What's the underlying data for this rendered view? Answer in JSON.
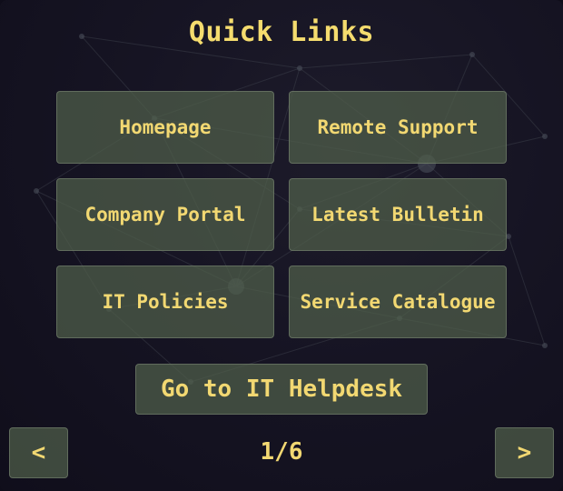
{
  "title": "Quick Links",
  "links": [
    {
      "label": "Homepage"
    },
    {
      "label": "Remote Support"
    },
    {
      "label": "Company Portal"
    },
    {
      "label": "Latest Bulletin"
    },
    {
      "label": "IT Policies"
    },
    {
      "label": "Service Catalogue"
    }
  ],
  "helpdesk_button": "Go to IT Helpdesk",
  "pagination": {
    "prev_label": "<",
    "next_label": ">",
    "current": "1/6"
  },
  "colors": {
    "text_accent": "#f2d872",
    "button_bg": "#505f4b",
    "background": "#141222"
  }
}
